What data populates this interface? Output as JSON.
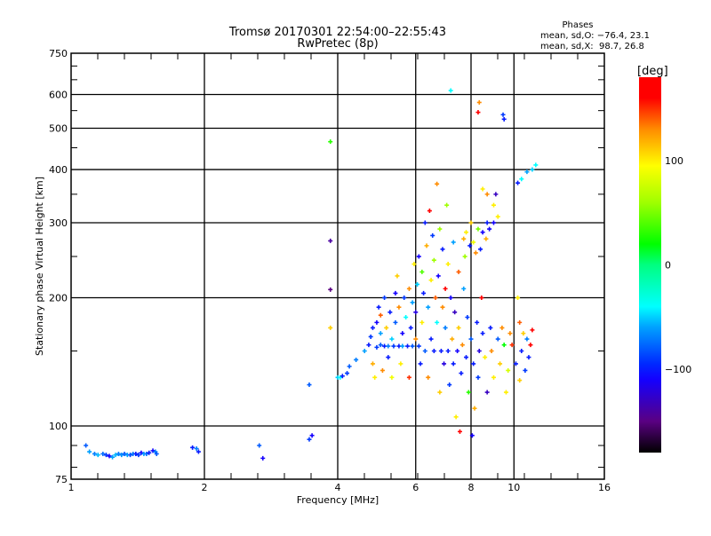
{
  "chart_data": {
    "type": "scatter",
    "title": "Tromsø 20170301 22:54:00–22:55:43",
    "subtitle": "RwPretec (8p)",
    "stats": {
      "heading": "Phases",
      "o_line": "mean, sd,O: −76.4, 23.1",
      "x_line": "mean, sd,X:  98.7, 26.8"
    },
    "xlabel": "Frequency [MHz]",
    "ylabel": "Stationary phase Virtual Height [km]",
    "xscale": "log2",
    "yscale": "log",
    "xlim": [
      1,
      16
    ],
    "ylim": [
      75,
      750
    ],
    "xticks": [
      1,
      2,
      4,
      6,
      8,
      10,
      16
    ],
    "yticks": [
      75,
      100,
      200,
      300,
      400,
      500,
      600,
      750
    ],
    "xgrid": [
      2,
      4,
      6,
      8,
      10
    ],
    "ygrid": [
      100,
      200,
      300,
      400,
      500,
      600
    ],
    "colorbar": {
      "label": "[deg]",
      "range": [
        -180,
        180
      ],
      "ticks": [
        100,
        0,
        -100
      ],
      "tick_labels": [
        "100",
        "0",
        "−100"
      ]
    },
    "point_format": [
      "frequency_MHz",
      "height_km",
      "phase_deg"
    ],
    "points": [
      [
        1.08,
        90,
        -80
      ],
      [
        1.1,
        87,
        -60
      ],
      [
        1.13,
        86,
        -70
      ],
      [
        1.15,
        85.5,
        -55
      ],
      [
        1.18,
        86,
        -75
      ],
      [
        1.2,
        85.5,
        -90
      ],
      [
        1.22,
        85,
        -110
      ],
      [
        1.24,
        84.5,
        -60
      ],
      [
        1.26,
        85.5,
        -55
      ],
      [
        1.28,
        86,
        -70
      ],
      [
        1.3,
        85.5,
        -65
      ],
      [
        1.32,
        86,
        -80
      ],
      [
        1.34,
        85.5,
        -60
      ],
      [
        1.36,
        85.5,
        -85
      ],
      [
        1.38,
        86,
        -70
      ],
      [
        1.4,
        86,
        -100
      ],
      [
        1.42,
        85.5,
        -90
      ],
      [
        1.44,
        86.5,
        -110
      ],
      [
        1.46,
        86,
        -60
      ],
      [
        1.48,
        86,
        -75
      ],
      [
        1.5,
        86.5,
        -100
      ],
      [
        1.53,
        87.5,
        -110
      ],
      [
        1.55,
        87,
        -70
      ],
      [
        1.56,
        86,
        -80
      ],
      [
        1.88,
        89,
        -100
      ],
      [
        1.92,
        88.5,
        -70
      ],
      [
        1.94,
        87,
        -100
      ],
      [
        2.66,
        90,
        -80
      ],
      [
        2.71,
        84,
        -110
      ],
      [
        3.45,
        93,
        -90
      ],
      [
        3.5,
        95,
        -110
      ],
      [
        3.45,
        125,
        -80
      ],
      [
        3.85,
        272,
        -140
      ],
      [
        3.85,
        209,
        -150
      ],
      [
        3.85,
        465,
        30
      ],
      [
        3.85,
        170,
        110
      ],
      [
        4.0,
        130,
        -50
      ],
      [
        4.05,
        130,
        -40
      ],
      [
        4.1,
        131,
        -100
      ],
      [
        4.2,
        133,
        -90
      ],
      [
        4.25,
        138,
        -80
      ],
      [
        4.4,
        143,
        -70
      ],
      [
        4.6,
        150,
        -60
      ],
      [
        4.7,
        155,
        -100
      ],
      [
        4.75,
        162,
        -90
      ],
      [
        4.8,
        170,
        -100
      ],
      [
        4.8,
        140,
        120
      ],
      [
        4.85,
        130,
        100
      ],
      [
        4.9,
        153,
        -90
      ],
      [
        4.9,
        175,
        -110
      ],
      [
        4.95,
        190,
        -100
      ],
      [
        5.0,
        155,
        -80
      ],
      [
        5.0,
        165,
        -60
      ],
      [
        5.0,
        182,
        140
      ],
      [
        5.05,
        135,
        130
      ],
      [
        5.1,
        154,
        -100
      ],
      [
        5.1,
        200,
        -90
      ],
      [
        5.15,
        170,
        110
      ],
      [
        5.2,
        154,
        -70
      ],
      [
        5.2,
        145,
        -100
      ],
      [
        5.25,
        185,
        -100
      ],
      [
        5.3,
        160,
        -50
      ],
      [
        5.3,
        130,
        90
      ],
      [
        5.35,
        154,
        -90
      ],
      [
        5.4,
        175,
        -80
      ],
      [
        5.4,
        205,
        -110
      ],
      [
        5.45,
        225,
        110
      ],
      [
        5.5,
        154,
        -100
      ],
      [
        5.5,
        190,
        130
      ],
      [
        5.55,
        140,
        100
      ],
      [
        5.6,
        154,
        -60
      ],
      [
        5.6,
        165,
        -110
      ],
      [
        5.65,
        200,
        -90
      ],
      [
        5.7,
        180,
        -40
      ],
      [
        5.75,
        154,
        -100
      ],
      [
        5.8,
        130,
        150
      ],
      [
        5.8,
        210,
        130
      ],
      [
        5.85,
        170,
        -100
      ],
      [
        5.9,
        154,
        -80
      ],
      [
        5.9,
        195,
        -60
      ],
      [
        5.95,
        240,
        100
      ],
      [
        6.0,
        185,
        -120
      ],
      [
        6.0,
        160,
        130
      ],
      [
        6.05,
        215,
        -50
      ],
      [
        6.1,
        154,
        -90
      ],
      [
        6.1,
        250,
        -110
      ],
      [
        6.15,
        140,
        -100
      ],
      [
        6.2,
        175,
        100
      ],
      [
        6.2,
        230,
        40
      ],
      [
        6.25,
        205,
        -100
      ],
      [
        6.3,
        300,
        -100
      ],
      [
        6.3,
        150,
        -80
      ],
      [
        6.35,
        265,
        120
      ],
      [
        6.4,
        190,
        -60
      ],
      [
        6.4,
        130,
        130
      ],
      [
        6.45,
        320,
        170
      ],
      [
        6.5,
        220,
        100
      ],
      [
        6.5,
        160,
        -100
      ],
      [
        6.55,
        280,
        -90
      ],
      [
        6.6,
        245,
        60
      ],
      [
        6.6,
        150,
        -100
      ],
      [
        6.65,
        200,
        140
      ],
      [
        6.7,
        370,
        130
      ],
      [
        6.7,
        175,
        -40
      ],
      [
        6.75,
        225,
        -110
      ],
      [
        6.8,
        290,
        60
      ],
      [
        6.8,
        120,
        110
      ],
      [
        6.85,
        150,
        -100
      ],
      [
        6.9,
        260,
        -100
      ],
      [
        6.9,
        190,
        130
      ],
      [
        6.95,
        140,
        -120
      ],
      [
        7.0,
        210,
        170
      ],
      [
        7.0,
        170,
        -70
      ],
      [
        7.05,
        330,
        60
      ],
      [
        7.1,
        150,
        -100
      ],
      [
        7.1,
        240,
        100
      ],
      [
        7.15,
        125,
        -90
      ],
      [
        7.2,
        200,
        -110
      ],
      [
        7.25,
        160,
        120
      ],
      [
        7.3,
        270,
        -60
      ],
      [
        7.3,
        140,
        -100
      ],
      [
        7.35,
        185,
        -130
      ],
      [
        7.4,
        105,
        100
      ],
      [
        7.45,
        150,
        -110
      ],
      [
        7.5,
        230,
        140
      ],
      [
        7.5,
        170,
        110
      ],
      [
        7.55,
        97,
        170
      ],
      [
        7.6,
        133,
        -100
      ],
      [
        7.65,
        155,
        130
      ],
      [
        7.7,
        275,
        120
      ],
      [
        7.7,
        210,
        -60
      ],
      [
        7.75,
        250,
        60
      ],
      [
        7.8,
        285,
        100
      ],
      [
        7.8,
        145,
        -100
      ],
      [
        7.85,
        180,
        -90
      ],
      [
        7.9,
        120,
        30
      ],
      [
        7.95,
        265,
        -100
      ],
      [
        8.0,
        300,
        110
      ],
      [
        8.0,
        160,
        -80
      ],
      [
        8.05,
        95,
        -110
      ],
      [
        8.1,
        270,
        90
      ],
      [
        8.1,
        140,
        -100
      ],
      [
        8.15,
        110,
        120
      ],
      [
        8.2,
        255,
        130
      ],
      [
        8.25,
        175,
        -100
      ],
      [
        8.3,
        290,
        50
      ],
      [
        8.3,
        130,
        -90
      ],
      [
        8.35,
        150,
        -120
      ],
      [
        8.4,
        260,
        -100
      ],
      [
        8.45,
        200,
        170
      ],
      [
        8.5,
        285,
        -110
      ],
      [
        8.5,
        165,
        -100
      ],
      [
        8.6,
        145,
        100
      ],
      [
        8.65,
        275,
        120
      ],
      [
        8.7,
        300,
        -100
      ],
      [
        8.7,
        120,
        -130
      ],
      [
        8.8,
        290,
        -110
      ],
      [
        8.85,
        170,
        -100
      ],
      [
        8.9,
        150,
        130
      ],
      [
        9.0,
        330,
        100
      ],
      [
        9.0,
        130,
        100
      ],
      [
        9.1,
        350,
        -130
      ],
      [
        9.2,
        160,
        -80
      ],
      [
        9.3,
        140,
        110
      ],
      [
        9.4,
        170,
        130
      ],
      [
        9.5,
        155,
        20
      ],
      [
        9.6,
        120,
        100
      ],
      [
        9.7,
        135,
        80
      ],
      [
        9.8,
        165,
        130
      ],
      [
        9.9,
        155,
        150
      ],
      [
        10.1,
        140,
        -100
      ],
      [
        10.2,
        200,
        100
      ],
      [
        10.3,
        175,
        140
      ],
      [
        10.4,
        150,
        -100
      ],
      [
        10.5,
        165,
        110
      ],
      [
        10.6,
        135,
        -90
      ],
      [
        10.7,
        160,
        -70
      ],
      [
        10.8,
        145,
        -100
      ],
      [
        10.9,
        155,
        170
      ],
      [
        11.0,
        168,
        160
      ],
      [
        10.3,
        128,
        110
      ],
      [
        10.2,
        372,
        -100
      ],
      [
        10.4,
        380,
        -40
      ],
      [
        10.7,
        395,
        -60
      ],
      [
        11.0,
        400,
        -50
      ],
      [
        11.2,
        410,
        -40
      ],
      [
        9.5,
        525,
        -100
      ],
      [
        9.45,
        538,
        -90
      ],
      [
        8.3,
        545,
        170
      ],
      [
        8.35,
        575,
        130
      ],
      [
        7.2,
        613,
        -40
      ],
      [
        8.5,
        360,
        100
      ],
      [
        8.7,
        350,
        130
      ],
      [
        9.2,
        310,
        100
      ],
      [
        9.0,
        300,
        -110
      ]
    ]
  }
}
